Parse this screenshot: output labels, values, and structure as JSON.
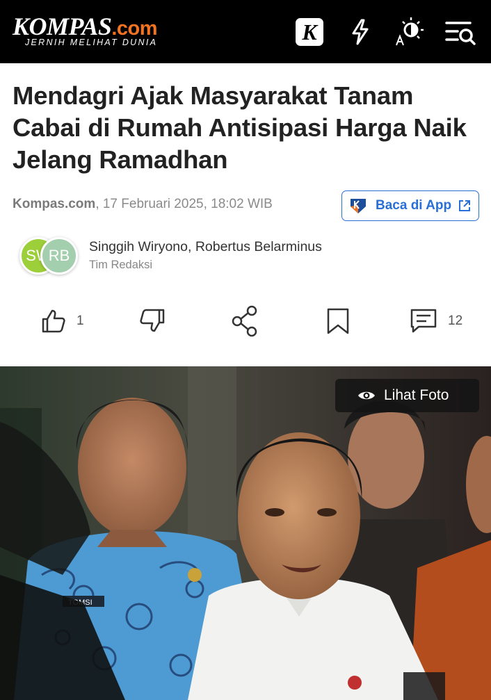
{
  "header": {
    "logo_main": "KOMPAS",
    "logo_suffix": ".com",
    "logo_tagline": "JERNIH MELIHAT DUNIA",
    "k_icon_letter": "K",
    "icons": [
      "kompas-k-icon",
      "flash-icon",
      "theme-toggle-icon",
      "menu-search-icon"
    ],
    "brand_color": "#f47321",
    "background": "#000000"
  },
  "article": {
    "headline": "Mendagri Ajak Masyarakat Tanam Cabai di Rumah Antisipasi Harga Naik Jelang Ramadhan",
    "source": "Kompas.com",
    "datetime": ", 17 Februari 2025, 18:02 WIB"
  },
  "app_button": {
    "label": "Baca di App",
    "color": "#2a6fd6"
  },
  "authors": {
    "avatars": [
      {
        "initials": "SW",
        "color": "#9ccf3a"
      },
      {
        "initials": "RB",
        "color": "#a3cfae"
      }
    ],
    "names": "Singgih Wiryono, Robertus Belarminus",
    "role": "Tim Redaksi"
  },
  "actions": {
    "like_count": "1",
    "comment_count": "12",
    "icons": [
      "thumbs-up-icon",
      "thumbs-down-icon",
      "share-icon",
      "bookmark-icon",
      "comment-icon"
    ]
  },
  "photo": {
    "view_label": "Lihat Foto",
    "name_tag": "TOMSI"
  }
}
